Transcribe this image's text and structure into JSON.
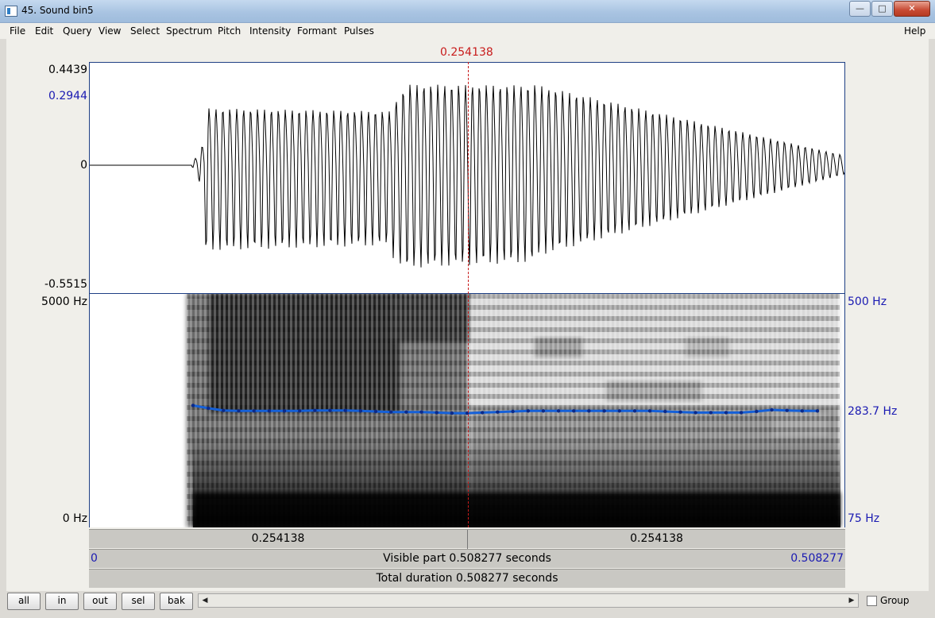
{
  "window": {
    "title": "45. Sound bin5",
    "minimize_glyph": "—",
    "maximize_glyph": "□",
    "close_glyph": "✕",
    "icon": "praat-window-icon"
  },
  "menu": {
    "items": [
      "File",
      "Edit",
      "Query",
      "View",
      "Select",
      "Spectrum",
      "Pitch",
      "Intensity",
      "Formant",
      "Pulses"
    ],
    "help": "Help"
  },
  "cursor": {
    "time_label": "0.254138"
  },
  "waveform": {
    "max_label": "0.4439",
    "cursor_value_label": "0.2944",
    "zero_label": "0",
    "min_label": "-0.5515"
  },
  "spectrogram": {
    "top_freq_label": "5000 Hz",
    "bottom_freq_label": "0 Hz",
    "pitch_top_label": "500 Hz",
    "pitch_value_label": "283.7 Hz",
    "pitch_bottom_label": "75 Hz"
  },
  "pitch_contour_hz": [
    297,
    292,
    288,
    287,
    287,
    287,
    287,
    287,
    288,
    288,
    288,
    287,
    286,
    285,
    285,
    285,
    284,
    283,
    283,
    284,
    285,
    286,
    287,
    287,
    287,
    287,
    287,
    287,
    287,
    287,
    287,
    286,
    285,
    284,
    284,
    284,
    284,
    286,
    289,
    288,
    287,
    287
  ],
  "time_bars": {
    "left_segment": "0.254138",
    "right_segment": "0.254138",
    "visible_start": "0",
    "visible_part": "Visible part 0.508277 seconds",
    "visible_end": "0.508277",
    "total_duration": "Total duration 0.508277 seconds"
  },
  "buttons": {
    "all": "all",
    "in": "in",
    "out": "out",
    "sel": "sel",
    "bak": "bak"
  },
  "scroll": {
    "left_arrow": "◀",
    "right_arrow": "▶"
  },
  "group": {
    "label": "Group",
    "checked": false
  },
  "colors": {
    "cursor": "#c81b1b",
    "pitch_line": "#1560d8",
    "axis_blue": "#1a1ab2"
  }
}
